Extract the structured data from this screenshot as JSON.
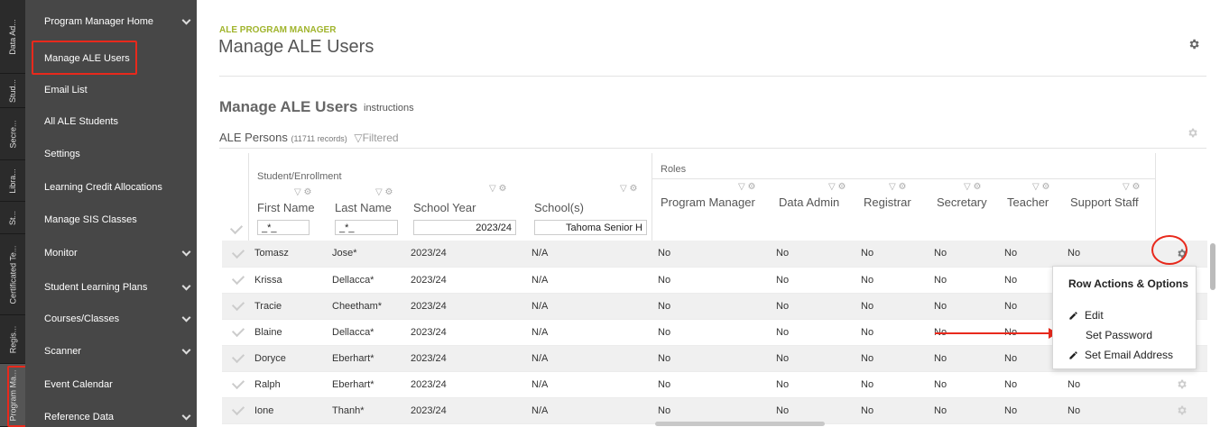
{
  "vtabs": [
    "Data Ad...",
    "Stud...",
    "Secre...",
    "Libra...",
    "St...",
    "Certificated Te...",
    "Regis...",
    "Program Ma..."
  ],
  "nav": [
    {
      "label": "Program Manager Home",
      "chevron": true
    },
    {
      "label": "Manage ALE Users",
      "chevron": false
    },
    {
      "label": "Email List",
      "chevron": false
    },
    {
      "label": "All ALE Students",
      "chevron": false
    },
    {
      "label": "Settings",
      "chevron": false
    },
    {
      "label": "Learning Credit Allocations",
      "chevron": false
    },
    {
      "label": "Manage SIS Classes",
      "chevron": false
    },
    {
      "label": "Monitor",
      "chevron": true
    },
    {
      "label": "Student Learning Plans",
      "chevron": true
    },
    {
      "label": "Courses/Classes",
      "chevron": true
    },
    {
      "label": "Scanner",
      "chevron": true
    },
    {
      "label": "Event Calendar",
      "chevron": false
    },
    {
      "label": "Reference Data",
      "chevron": true
    }
  ],
  "header": {
    "overline": "ALE PROGRAM MANAGER",
    "title": "Manage ALE Users"
  },
  "section": {
    "title": "Manage ALE Users",
    "instructions": "instructions"
  },
  "grid": {
    "name": "ALE Persons",
    "record_count": "(11711 records)",
    "filtered": "Filtered",
    "group_student": "Student/Enrollment",
    "group_roles": "Roles",
    "columns": [
      "First Name",
      "Last Name",
      "School Year",
      "School(s)",
      "Program Manager",
      "Data Admin",
      "Registrar",
      "Secretary",
      "Teacher",
      "Support Staff"
    ],
    "filters": {
      "first": "_*_",
      "last": "_*_",
      "year": "2023/24",
      "school": "Tahoma Senior H"
    },
    "rows": [
      [
        "Tomasz",
        "Jose*",
        "2023/24",
        "N/A",
        "No",
        "No",
        "No",
        "No",
        "No",
        "No"
      ],
      [
        "Krissa",
        "Dellacca*",
        "2023/24",
        "N/A",
        "No",
        "No",
        "No",
        "No",
        "No",
        ""
      ],
      [
        "Tracie",
        "Cheetham*",
        "2023/24",
        "N/A",
        "No",
        "No",
        "No",
        "No",
        "No",
        ""
      ],
      [
        "Blaine",
        "Dellacca*",
        "2023/24",
        "N/A",
        "No",
        "No",
        "No",
        "No",
        "No",
        ""
      ],
      [
        "Doryce",
        "Eberhart*",
        "2023/24",
        "N/A",
        "No",
        "No",
        "No",
        "No",
        "No",
        ""
      ],
      [
        "Ralph",
        "Eberhart*",
        "2023/24",
        "N/A",
        "No",
        "No",
        "No",
        "No",
        "No",
        "No"
      ],
      [
        "Ione",
        "Thanh*",
        "2023/24",
        "N/A",
        "No",
        "No",
        "No",
        "No",
        "No",
        "No"
      ]
    ]
  },
  "menu": {
    "title": "Row Actions & Options",
    "items": [
      {
        "label": "Edit",
        "icon": "pencil-icon"
      },
      {
        "label": "Set Password",
        "icon": ""
      },
      {
        "label": "Set Email Address",
        "icon": "pencil-icon"
      }
    ]
  },
  "colors": {
    "accent": "#a0b42c",
    "nav_bg": "#474747",
    "highlight": "#e8291c"
  }
}
